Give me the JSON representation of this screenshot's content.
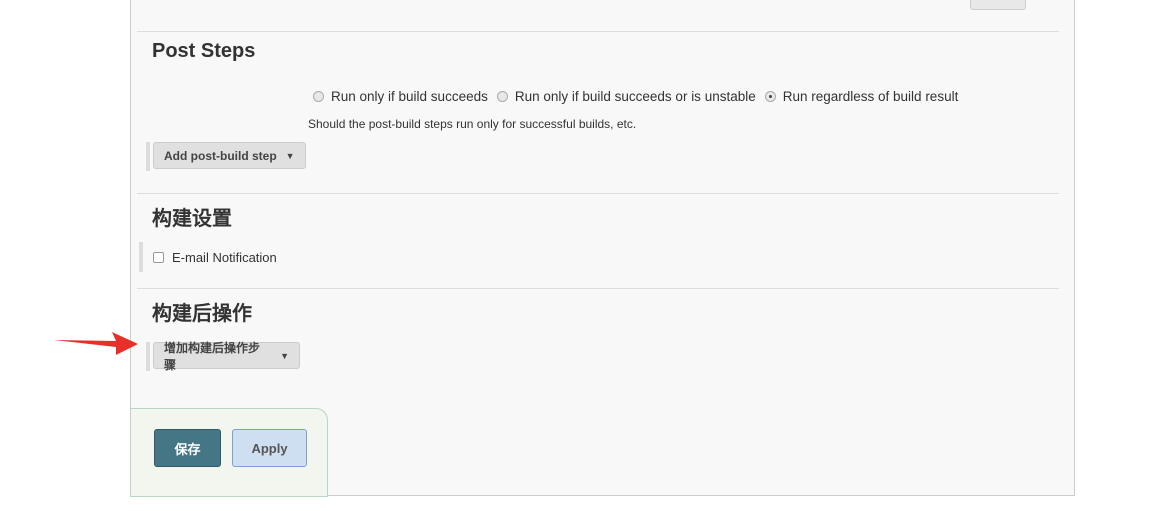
{
  "post_steps": {
    "title": "Post Steps",
    "options": [
      "Run only if build succeeds",
      "Run only if build succeeds or is unstable",
      "Run regardless of build result"
    ],
    "selected": 2,
    "help": "Should the post-build steps run only for successful builds, etc.",
    "add_button": "Add post-build step"
  },
  "build_settings": {
    "title": "构建设置",
    "email_label": "E-mail Notification"
  },
  "post_build": {
    "title": "构建后操作",
    "add_button": "增加构建后操作步骤"
  },
  "footer": {
    "save": "保存",
    "apply": "Apply"
  },
  "colors": {
    "arrow": "#e8302a",
    "save": "#457686",
    "apply": "#cddff0"
  }
}
